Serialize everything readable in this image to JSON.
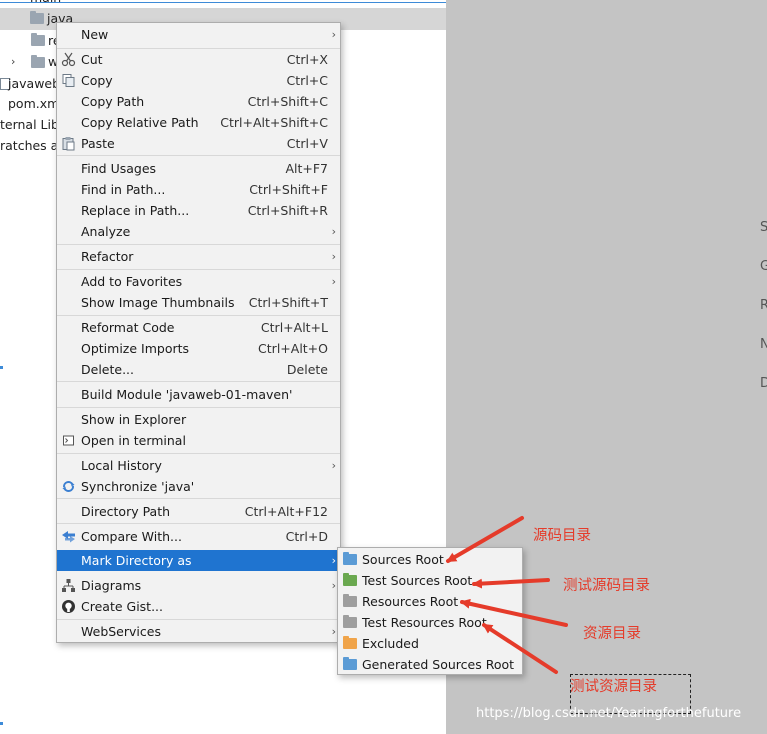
{
  "tree": {
    "items": [
      {
        "label": "main"
      },
      {
        "label": "java"
      },
      {
        "label": "re"
      },
      {
        "label": "w"
      },
      {
        "label": "javaweb"
      },
      {
        "label": "pom.xm"
      },
      {
        "label": "ternal Lib"
      },
      {
        "label": "ratches ar"
      }
    ]
  },
  "editor_edge_letters": [
    "S",
    "G",
    "R",
    "N",
    "D"
  ],
  "menu": {
    "new": {
      "label": "New"
    },
    "cut": {
      "label": "Cut",
      "shortcut": "Ctrl+X"
    },
    "copy": {
      "label": "Copy",
      "shortcut": "Ctrl+C"
    },
    "copy_path": {
      "label": "Copy Path",
      "shortcut": "Ctrl+Shift+C"
    },
    "copy_relative_path": {
      "label": "Copy Relative Path",
      "shortcut": "Ctrl+Alt+Shift+C"
    },
    "paste": {
      "label": "Paste",
      "shortcut": "Ctrl+V"
    },
    "find_usages": {
      "label": "Find Usages",
      "shortcut": "Alt+F7"
    },
    "find_in_path": {
      "label": "Find in Path...",
      "shortcut": "Ctrl+Shift+F"
    },
    "replace_in_path": {
      "label": "Replace in Path...",
      "shortcut": "Ctrl+Shift+R"
    },
    "analyze": {
      "label": "Analyze"
    },
    "refactor": {
      "label": "Refactor"
    },
    "add_to_favorites": {
      "label": "Add to Favorites"
    },
    "show_image_thumbnails": {
      "label": "Show Image Thumbnails",
      "shortcut": "Ctrl+Shift+T"
    },
    "reformat_code": {
      "label": "Reformat Code",
      "shortcut": "Ctrl+Alt+L"
    },
    "optimize_imports": {
      "label": "Optimize Imports",
      "shortcut": "Ctrl+Alt+O"
    },
    "delete": {
      "label": "Delete...",
      "shortcut": "Delete"
    },
    "build_module": {
      "label": "Build Module 'javaweb-01-maven'"
    },
    "show_in_explorer": {
      "label": "Show in Explorer"
    },
    "open_in_terminal": {
      "label": "Open in terminal"
    },
    "local_history": {
      "label": "Local History"
    },
    "synchronize": {
      "label": "Synchronize 'java'"
    },
    "directory_path": {
      "label": "Directory Path",
      "shortcut": "Ctrl+Alt+F12"
    },
    "compare_with": {
      "label": "Compare With...",
      "shortcut": "Ctrl+D"
    },
    "mark_directory_as": {
      "label": "Mark Directory as"
    },
    "diagrams": {
      "label": "Diagrams"
    },
    "create_gist": {
      "label": "Create Gist..."
    },
    "webservices": {
      "label": "WebServices"
    }
  },
  "submenu": {
    "items": [
      {
        "label": "Sources Root",
        "color": "#5b9bd5"
      },
      {
        "label": "Test Sources Root",
        "color": "#6aa84f"
      },
      {
        "label": "Resources Root",
        "color": "#9e9e9e"
      },
      {
        "label": "Test Resources Root",
        "color": "#9e9e9e"
      },
      {
        "label": "Excluded",
        "color": "#f0a44a"
      },
      {
        "label": "Generated Sources Root",
        "color": "#5b9bd5"
      }
    ]
  },
  "annotations": {
    "sources": "源码目录",
    "test_sources": "测试源码目录",
    "resources": "资源目录",
    "test_resources": "测试资源目录"
  },
  "watermark": "https://blog.csdn.net/Yearingforthefuture",
  "colors": {
    "selection": "#1f74d0",
    "annotation": "#e53b2a",
    "editor_bg": "#c4c4c4",
    "menu_bg": "#f2f2f2"
  }
}
